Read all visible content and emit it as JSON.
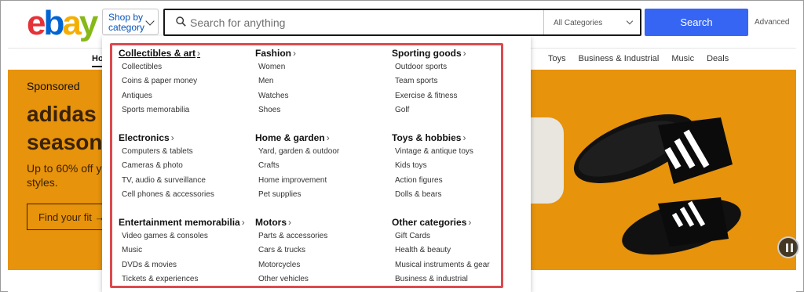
{
  "header": {
    "logo": {
      "e": "e",
      "b": "b",
      "a": "a",
      "y": "y"
    },
    "shop_by_category_line1": "Shop by",
    "shop_by_category_line2": "category",
    "search_placeholder": "Search for anything",
    "category_select": "All Categories",
    "search_button": "Search",
    "advanced_link": "Advanced"
  },
  "nav": {
    "home": "Ho",
    "items": [
      "Toys",
      "Business & Industrial",
      "Music",
      "Deals"
    ]
  },
  "banner": {
    "sponsored": "Sponsored",
    "headline_line1": "adidas",
    "headline_line2": "season",
    "subtext_line1": "Up to 60% off y",
    "subtext_line2": "styles.",
    "cta": "Find your fit →",
    "brand_color": "#e7930c"
  },
  "dropdown": {
    "columns": [
      [
        {
          "title": "Collectibles & art",
          "items": [
            "Collectibles",
            "Coins & paper money",
            "Antiques",
            "Sports memorabilia"
          ]
        },
        {
          "title": "Electronics",
          "items": [
            "Computers & tablets",
            "Cameras & photo",
            "TV, audio & surveillance",
            "Cell phones & accessories"
          ]
        },
        {
          "title": "Entertainment memorabilia",
          "items": [
            "Video games & consoles",
            "Music",
            "DVDs & movies",
            "Tickets & experiences"
          ]
        }
      ],
      [
        {
          "title": "Fashion",
          "items": [
            "Women",
            "Men",
            "Watches",
            "Shoes"
          ]
        },
        {
          "title": "Home & garden",
          "items": [
            "Yard, garden & outdoor",
            "Crafts",
            "Home improvement",
            "Pet supplies"
          ]
        },
        {
          "title": "Motors",
          "items": [
            "Parts & accessories",
            "Cars & trucks",
            "Motorcycles",
            "Other vehicles"
          ]
        }
      ],
      [
        {
          "title": "Sporting goods",
          "items": [
            "Outdoor sports",
            "Team sports",
            "Exercise & fitness",
            "Golf"
          ]
        },
        {
          "title": "Toys & hobbies",
          "items": [
            "Vintage & antique toys",
            "Kids toys",
            "Action figures",
            "Dolls & bears"
          ]
        },
        {
          "title": "Other categories",
          "items": [
            "Gift Cards",
            "Health & beauty",
            "Musical instruments & gear",
            "Business & industrial"
          ]
        }
      ]
    ],
    "highlight_color": "#dc4a4f"
  },
  "icons": {
    "search": "search-icon",
    "chevron": "chevron-down-icon",
    "pause": "pause-icon"
  }
}
